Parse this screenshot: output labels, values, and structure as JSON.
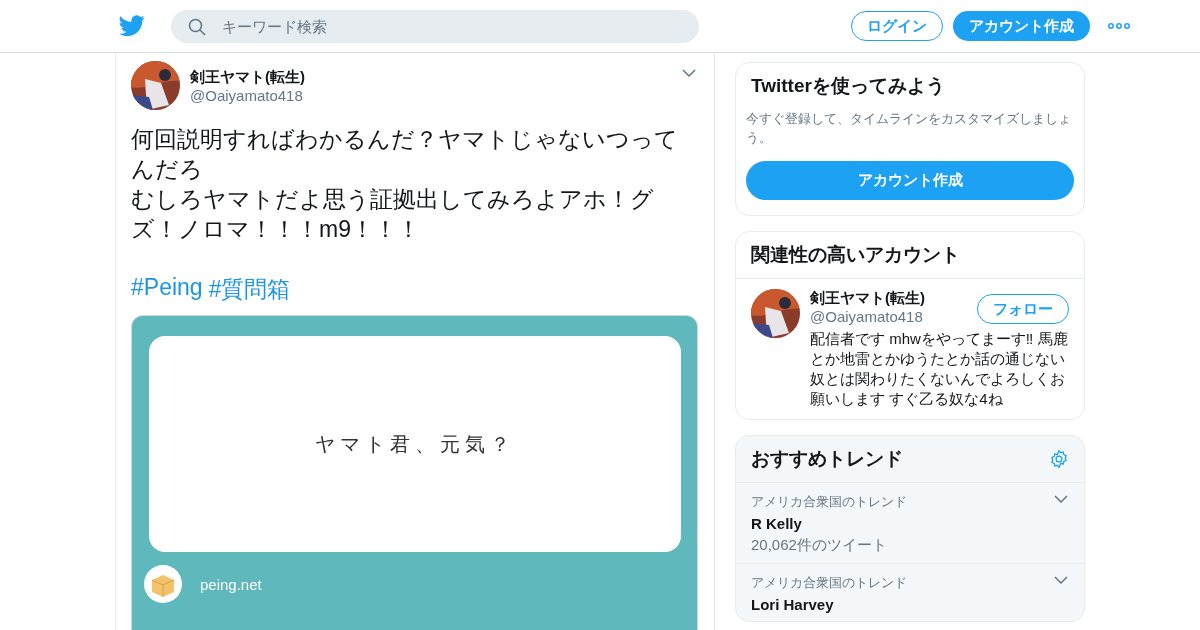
{
  "header": {
    "search": {
      "placeholder": "キーワード検索"
    },
    "login": "ログイン",
    "signup": "アカウント作成"
  },
  "tweet": {
    "name": "剣王ヤマト(転生)",
    "handle": "@Oaiyamato418",
    "lines": [
      "何回説明すればわかるんだ？ヤマトじゃないつってんだろ",
      "むしろヤマトだよ思う証拠出してみろよアホ！グズ！ノロマ！！！m9！！！"
    ],
    "hashtags": [
      "#Peing",
      "#質問箱"
    ],
    "card": {
      "question": "ヤマト君、元気？",
      "site": "peing.net"
    }
  },
  "signup_card": {
    "title": "Twitterを使ってみよう",
    "text": "今すぐ登録して、タイムラインをカスタマイズしましょう。",
    "button": "アカウント作成"
  },
  "related": {
    "title": "関連性の高いアカウント",
    "accounts": [
      {
        "name": "剣王ヤマト(転生)",
        "handle": "@Oaiyamato418",
        "follow": "フォロー",
        "bio": "配信者です mhwをやってまーす‼ 馬鹿とか地雷とかゆうたとか話の通じない奴とは関わりたくないんでよろしくお願いします すぐ乙る奴な4ね"
      }
    ]
  },
  "trends": {
    "title": "おすすめトレンド",
    "items": [
      {
        "context": "アメリカ合衆国のトレンド",
        "name": "R Kelly",
        "count": "20,062件のツイート"
      },
      {
        "context": "アメリカ合衆国のトレンド",
        "name": "Lori Harvey"
      }
    ]
  }
}
